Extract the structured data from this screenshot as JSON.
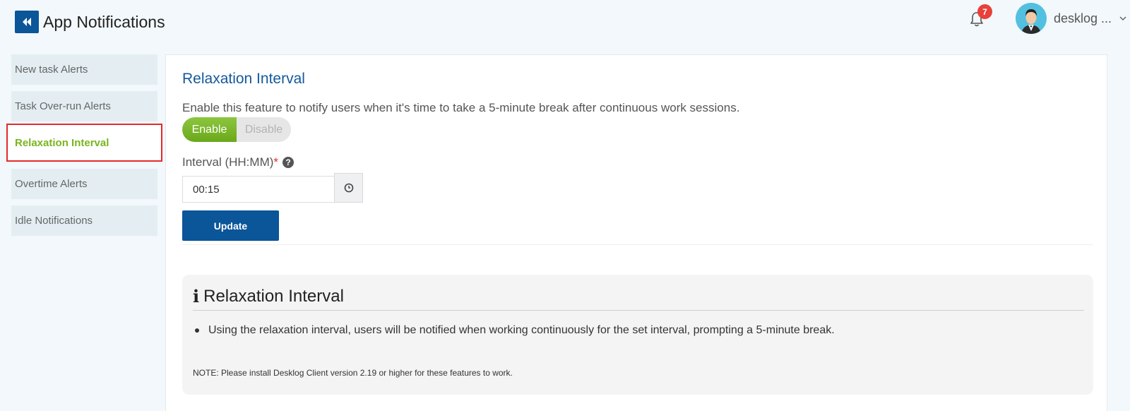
{
  "header": {
    "title": "App Notifications",
    "back_icon": "double-chevron-left-icon",
    "notification_count": "7",
    "user_name": "desklog ..."
  },
  "sidebar": {
    "items": [
      {
        "label": "New task Alerts",
        "active": false
      },
      {
        "label": "Task Over-run Alerts",
        "active": false
      },
      {
        "label": "Relaxation Interval",
        "active": true
      },
      {
        "label": "Overtime Alerts",
        "active": false
      },
      {
        "label": "Idle Notifications",
        "active": false
      }
    ]
  },
  "main": {
    "section_title": "Relaxation Interval",
    "description": "Enable this feature to notify users when it's time to take a 5-minute break after continuous work sessions.",
    "toggle": {
      "enable_label": "Enable",
      "disable_label": "Disable",
      "selected": "Enable"
    },
    "interval": {
      "label": "Interval (HH:MM)",
      "required_mark": "*",
      "value": "00:15"
    },
    "update_label": "Update",
    "info": {
      "title": "Relaxation Interval",
      "bullet": "Using the relaxation interval, users will be notified when working continuously for the set interval, prompting a 5-minute break.",
      "note": "NOTE: Please install Desklog Client version 2.19 or higher for these features to work."
    }
  },
  "colors": {
    "brand_blue": "#0b5599",
    "accent_green": "#7ab51d",
    "badge_red": "#e8403a",
    "highlight_red": "#e32a2a"
  }
}
